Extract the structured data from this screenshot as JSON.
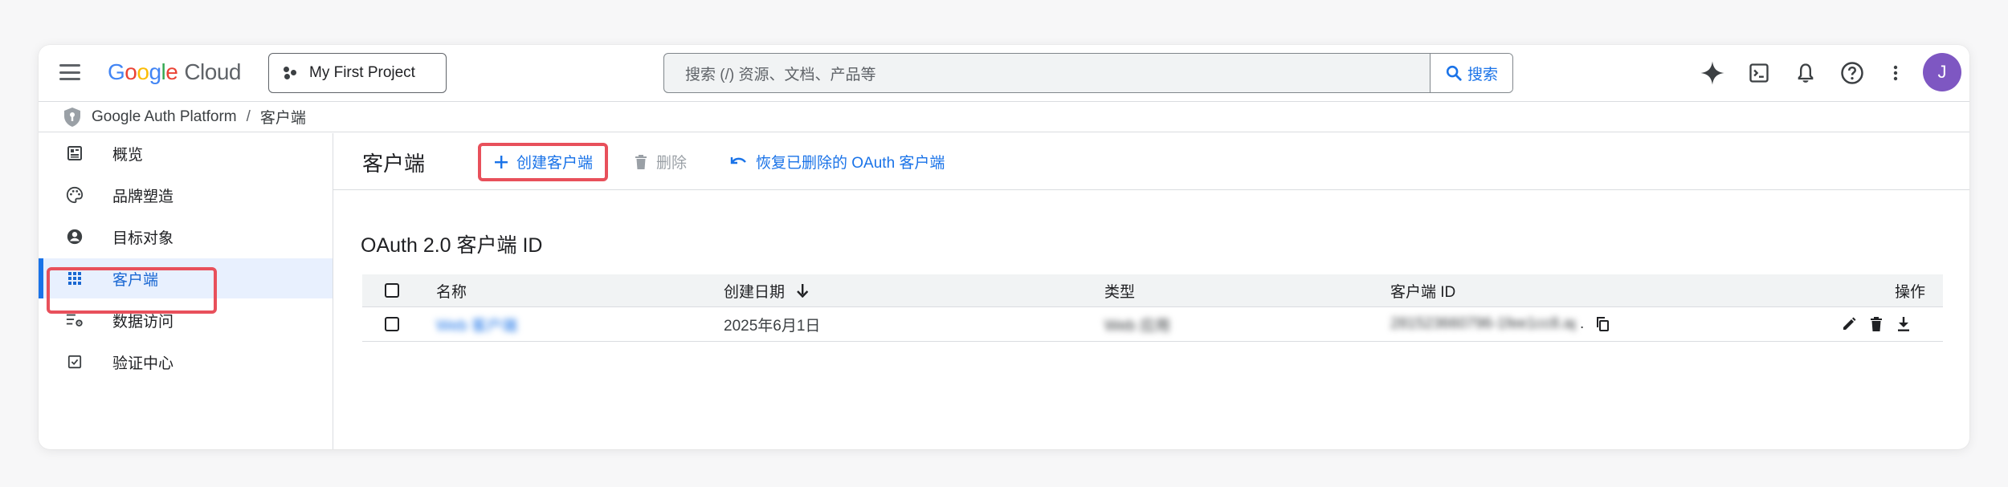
{
  "header": {
    "logo_google": "Google",
    "logo_cloud": "Cloud",
    "project_label": "My First Project",
    "search_placeholder": "搜索 (/) 资源、文档、产品等",
    "search_button": "搜索",
    "avatar_initial": "J"
  },
  "breadcrumb": {
    "root": "Google Auth Platform",
    "separator": "/",
    "current": "客户端"
  },
  "sidebar": {
    "items": [
      {
        "label": "概览",
        "icon": "overview-icon"
      },
      {
        "label": "品牌塑造",
        "icon": "palette-icon"
      },
      {
        "label": "目标对象",
        "icon": "person-icon"
      },
      {
        "label": "客户端",
        "icon": "grid-icon",
        "active": true
      },
      {
        "label": "数据访问",
        "icon": "data-settings-icon"
      },
      {
        "label": "验证中心",
        "icon": "checkbox-icon"
      }
    ]
  },
  "actionbar": {
    "title": "客户端",
    "create": "创建客户端",
    "delete": "删除",
    "restore": "恢复已删除的 OAuth 客户端"
  },
  "section_title": "OAuth 2.0 客户端 ID",
  "table": {
    "columns": [
      "名称",
      "创建日期",
      "类型",
      "客户端 ID",
      "操作"
    ],
    "rows": [
      {
        "name": "Web 客户端",
        "created": "2025年6月1日",
        "type": "Web 应用",
        "client_id": "281523660796-1fee1cc8.apps",
        "client_id_suffix": "."
      }
    ]
  },
  "colors": {
    "accent": "#1a73e8",
    "highlight": "#e8505b",
    "active_bg": "#e8f0fe",
    "avatar": "#7e57c2"
  }
}
